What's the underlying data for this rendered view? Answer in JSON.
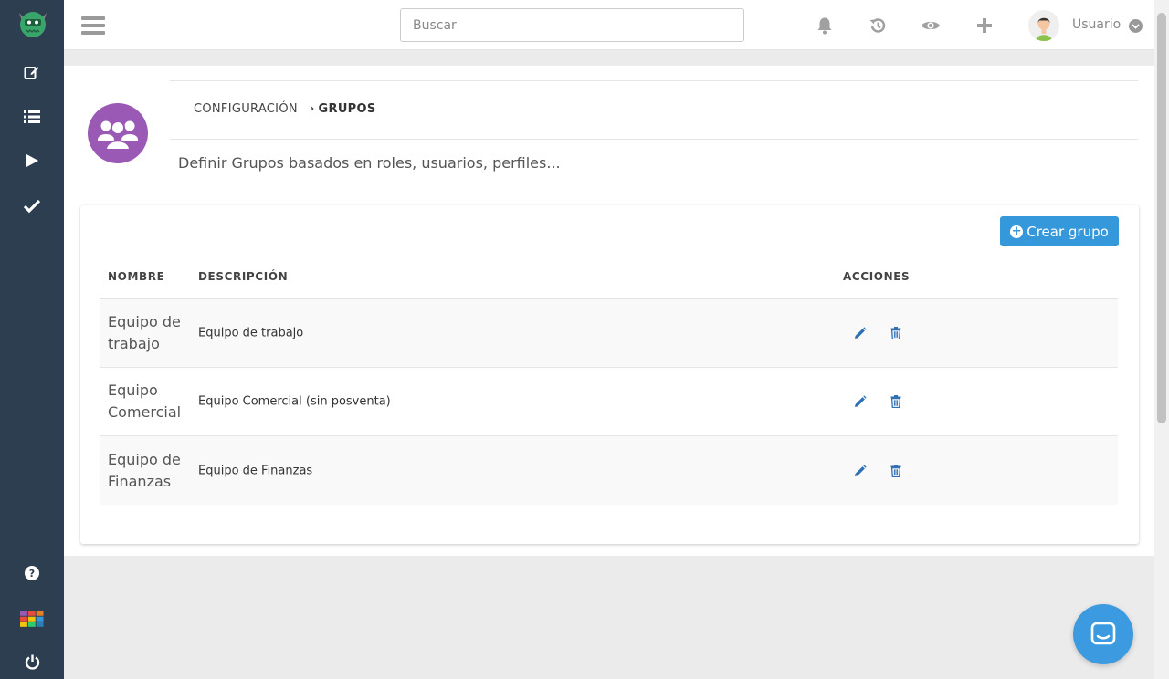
{
  "topbar": {
    "search_placeholder": "Buscar",
    "user_name": "Usuario"
  },
  "sidebar": {
    "items": [
      {
        "icon": "edit-icon"
      },
      {
        "icon": "list-icon"
      },
      {
        "icon": "play-icon"
      },
      {
        "icon": "check-icon"
      }
    ],
    "bottom": [
      {
        "icon": "help-icon"
      },
      {
        "icon": "apps-grid-icon"
      },
      {
        "icon": "power-icon"
      }
    ]
  },
  "header": {
    "breadcrumb_parent": "CONFIGURACIÓN",
    "breadcrumb_current": "GRUPOS",
    "description": "Definir Grupos basados en roles, usuarios, perfiles..."
  },
  "card": {
    "create_button": "Crear grupo",
    "columns": {
      "name": "NOMBRE",
      "description": "DESCRIPCIÓN",
      "actions": "ACCIONES"
    },
    "rows": [
      {
        "name": "Equipo de trabajo",
        "description": "Equipo de trabajo"
      },
      {
        "name": "Equipo Comercial",
        "description": "Equipo Comercial (sin posventa)"
      },
      {
        "name": "Equipo de Finanzas",
        "description": "Equipo de Finanzas"
      }
    ]
  },
  "colors": {
    "sidebar": "#2c3e50",
    "accent": "#3498db",
    "group_logo": "#9b59b6"
  }
}
